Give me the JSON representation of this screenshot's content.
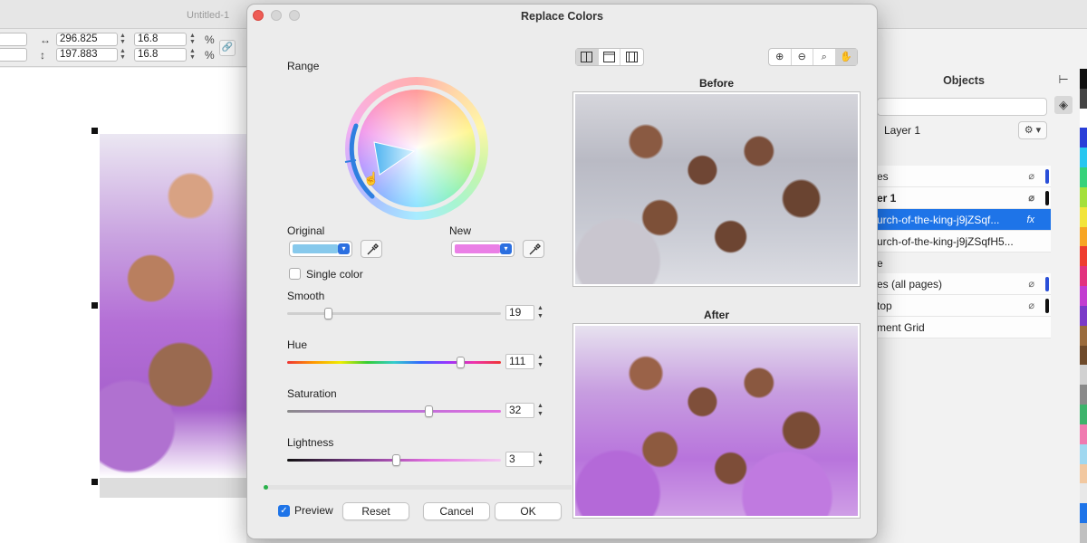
{
  "background_app": {
    "document_title": "Untitled-1",
    "toolbar": {
      "width_value": "296.825",
      "height_value": "197.883",
      "scale_x": "16.8",
      "scale_y": "16.8",
      "percent_x": "%",
      "percent_y": "%"
    },
    "objects_panel": {
      "title": "Objects",
      "layer_label": "Layer 1",
      "rows": [
        {
          "label": "es",
          "style": "normal",
          "bar_color": "#2a4fd8"
        },
        {
          "label": "er 1",
          "style": "bold",
          "bar_color": "#111111"
        },
        {
          "label": "urch-of-the-king-j9jZSqf...",
          "style": "selected",
          "bar_color": ""
        },
        {
          "label": "urch-of-the-king-j9jZSqfH5...",
          "style": "normal",
          "bar_color": ""
        },
        {
          "label": "e",
          "style": "section",
          "bar_color": ""
        },
        {
          "label": "es (all pages)",
          "style": "normal",
          "bar_color": "#2a4fd8"
        },
        {
          "label": "top",
          "style": "normal",
          "bar_color": "#111111"
        },
        {
          "label": "ment Grid",
          "style": "normal",
          "bar_color": ""
        }
      ]
    },
    "palette": [
      "#111111",
      "#444444",
      "#ffffff",
      "#2a3fd8",
      "#28c6f0",
      "#36d27a",
      "#a4e03a",
      "#f2e43a",
      "#f7a524",
      "#ee3d2f",
      "#e2327e",
      "#c23cd0",
      "#7a3ac8",
      "#9a6b3c",
      "#6e4a2a",
      "#d1d1d1",
      "#8a8a8a",
      "#3db36b",
      "#f07ab0",
      "#a0d8f0",
      "#f2c8a0",
      "#e8e8e8",
      "#1e74e8",
      "#c0c0c0"
    ]
  },
  "dialog": {
    "title": "Replace Colors",
    "range_label": "Range",
    "original_label": "Original",
    "new_label": "New",
    "original_color": "#87c9ec",
    "new_color": "#ea7fe6",
    "single_color_label": "Single color",
    "single_color_checked": false,
    "sliders": [
      {
        "key": "smooth",
        "label": "Smooth",
        "value": "19",
        "fraction": 0.19
      },
      {
        "key": "hue",
        "label": "Hue",
        "value": "111",
        "fraction": 0.81
      },
      {
        "key": "saturation",
        "label": "Saturation",
        "value": "32",
        "fraction": 0.66
      },
      {
        "key": "lightness",
        "label": "Lightness",
        "value": "3",
        "fraction": 0.51
      }
    ],
    "preview_label": "Preview",
    "preview_checked": true,
    "buttons": {
      "reset": "Reset",
      "cancel": "Cancel",
      "ok": "OK"
    },
    "before_label": "Before",
    "after_label": "After",
    "zoom_tools": [
      "zoom-in-icon",
      "zoom-out-icon",
      "zoom-fit-icon",
      "hand-icon"
    ],
    "view_modes": [
      "split-vertical-icon",
      "single-view-icon",
      "split-horizontal-icon"
    ]
  }
}
